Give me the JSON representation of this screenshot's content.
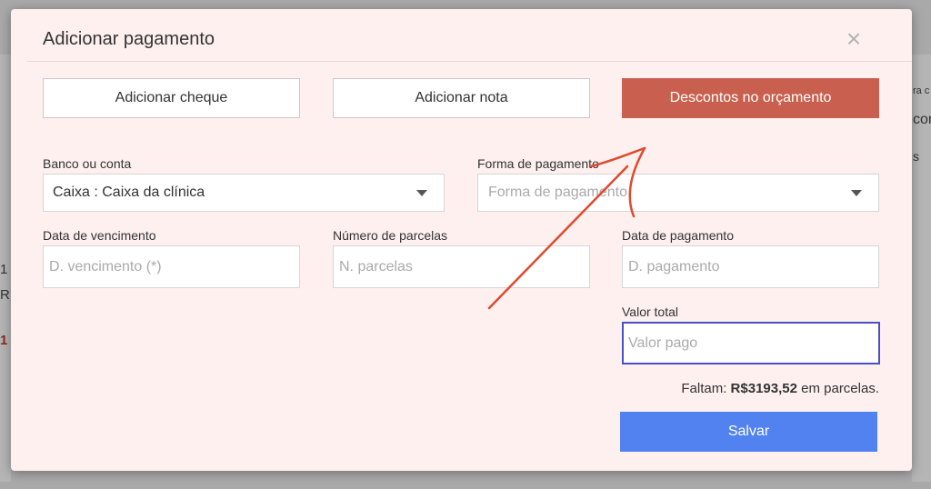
{
  "modal": {
    "title": "Adicionar pagamento",
    "close_symbol": "×"
  },
  "actions": {
    "add_check": "Adicionar cheque",
    "add_note": "Adicionar nota",
    "budget_discounts": "Descontos no orçamento"
  },
  "form": {
    "bank_label": "Banco ou conta",
    "bank_value": "Caixa : Caixa da clínica",
    "payment_method_label": "Forma de pagamento",
    "payment_method_placeholder": "Forma de pagamento",
    "due_date_label": "Data de vencimento",
    "due_date_placeholder": "D. vencimento (*)",
    "installments_label": "Número de parcelas",
    "installments_placeholder": "N. parcelas",
    "payment_date_label": "Data de pagamento",
    "payment_date_placeholder": "D. pagamento",
    "total_label": "Valor total",
    "total_placeholder": "Valor pago"
  },
  "summary": {
    "prefix": "Faltam:",
    "amount": "R$3193,52",
    "suffix": "em parcelas."
  },
  "save_label": "Salvar",
  "background": {
    "fragment_1": "1",
    "fragment_2": "R",
    "fragment_3": "1",
    "fragment_4": "ra c",
    "fragment_5": "con",
    "fragment_6": "s"
  },
  "colors": {
    "accent_discount": "#c9604f",
    "save_button": "#5282f0",
    "focus_border": "#4b4fc4",
    "annotation": "#e04a2f"
  }
}
